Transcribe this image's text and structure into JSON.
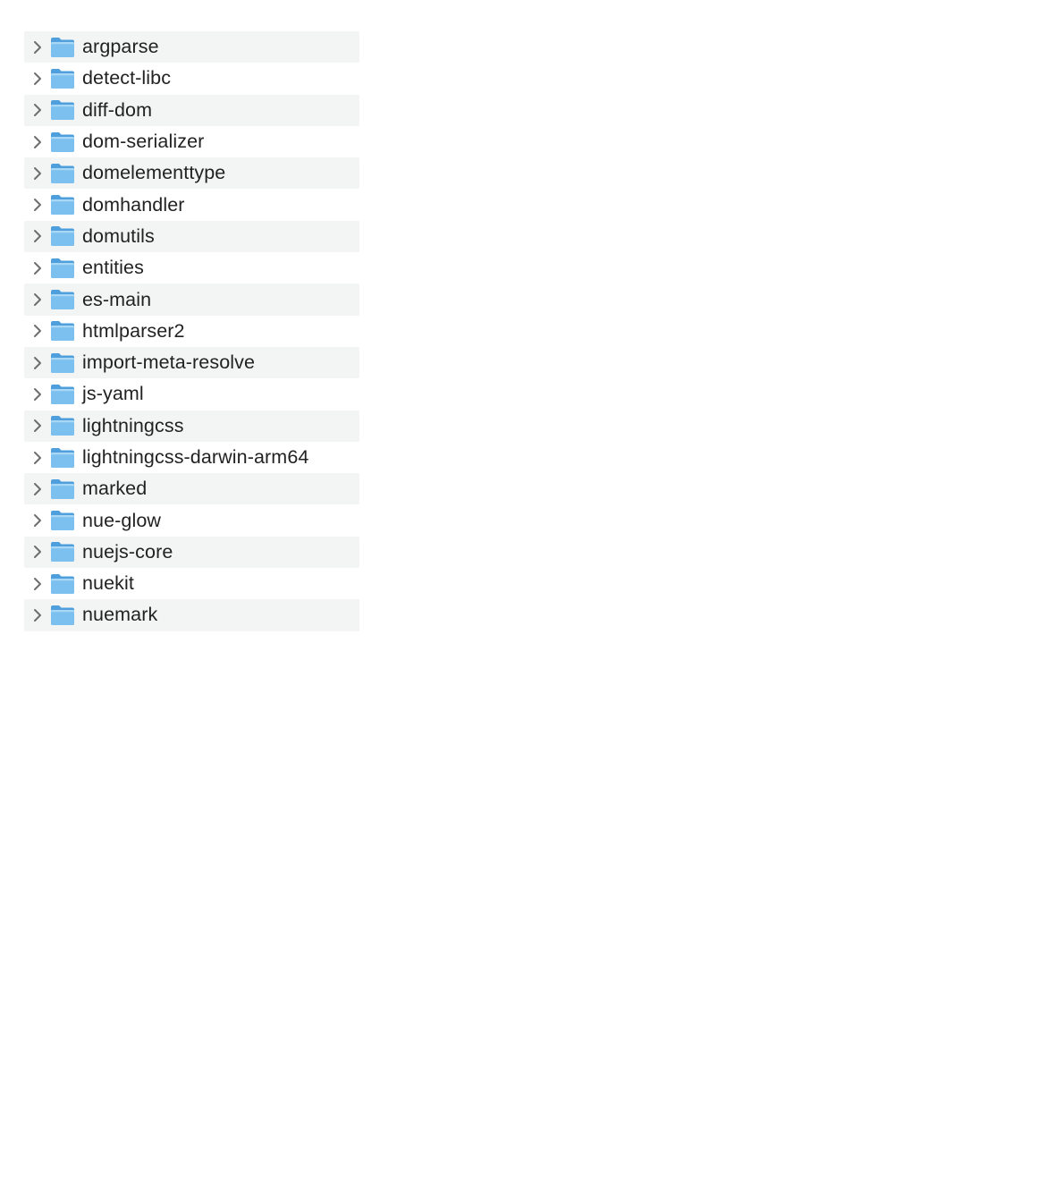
{
  "file_list": {
    "items": [
      {
        "name": "argparse",
        "icon": "folder-icon",
        "expanded": false
      },
      {
        "name": "detect-libc",
        "icon": "folder-icon",
        "expanded": false
      },
      {
        "name": "diff-dom",
        "icon": "folder-icon",
        "expanded": false
      },
      {
        "name": "dom-serializer",
        "icon": "folder-icon",
        "expanded": false
      },
      {
        "name": "domelementtype",
        "icon": "folder-icon",
        "expanded": false
      },
      {
        "name": "domhandler",
        "icon": "folder-icon",
        "expanded": false
      },
      {
        "name": "domutils",
        "icon": "folder-icon",
        "expanded": false
      },
      {
        "name": "entities",
        "icon": "folder-icon",
        "expanded": false
      },
      {
        "name": "es-main",
        "icon": "folder-icon",
        "expanded": false
      },
      {
        "name": "htmlparser2",
        "icon": "folder-icon",
        "expanded": false
      },
      {
        "name": "import-meta-resolve",
        "icon": "folder-icon",
        "expanded": false
      },
      {
        "name": "js-yaml",
        "icon": "folder-icon",
        "expanded": false
      },
      {
        "name": "lightningcss",
        "icon": "folder-icon",
        "expanded": false
      },
      {
        "name": "lightningcss-darwin-arm64",
        "icon": "folder-icon",
        "expanded": false
      },
      {
        "name": "marked",
        "icon": "folder-icon",
        "expanded": false
      },
      {
        "name": "nue-glow",
        "icon": "folder-icon",
        "expanded": false
      },
      {
        "name": "nuejs-core",
        "icon": "folder-icon",
        "expanded": false
      },
      {
        "name": "nuekit",
        "icon": "folder-icon",
        "expanded": false
      },
      {
        "name": "nuemark",
        "icon": "folder-icon",
        "expanded": false
      }
    ]
  },
  "colors": {
    "stripe": "#f3f4f4",
    "text": "#222222",
    "chevron": "#6e6e6e",
    "folder_back": "#4f9fdc",
    "folder_front": "#7cc0ef"
  }
}
